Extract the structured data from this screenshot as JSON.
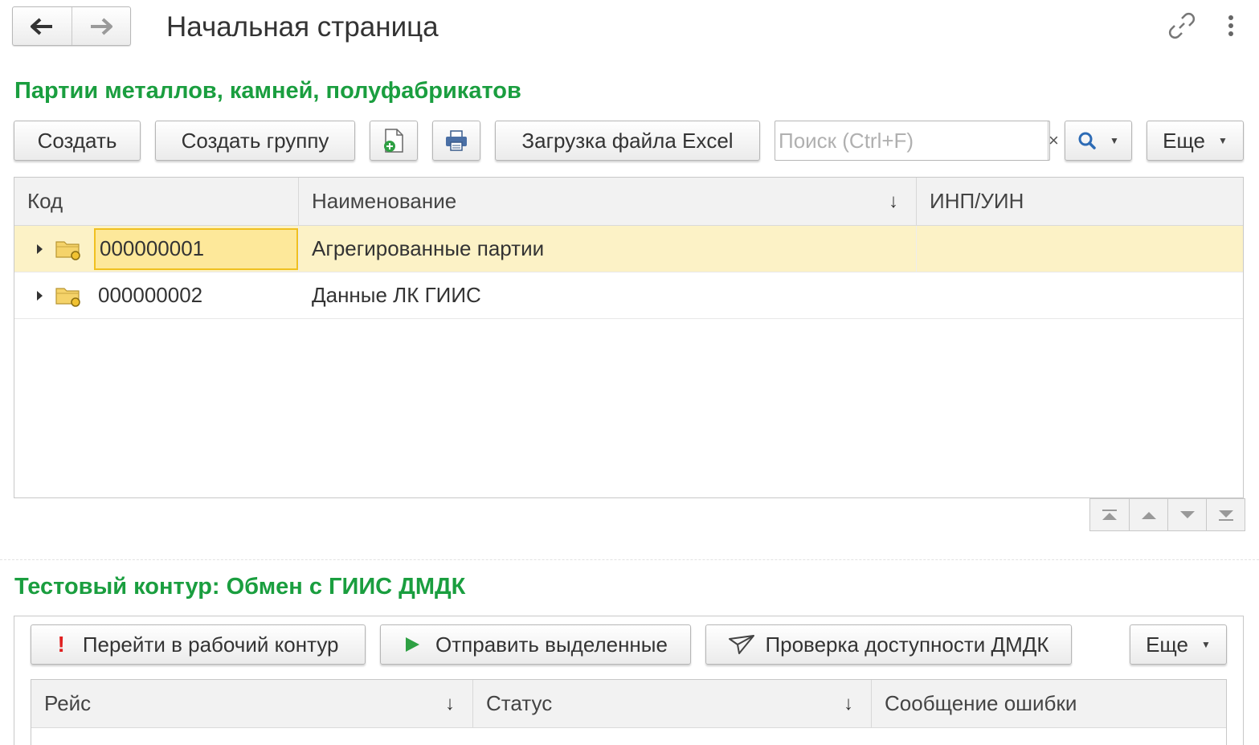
{
  "header": {
    "back_icon": "arrow-left-icon",
    "forward_icon": "arrow-right-icon",
    "title": "Начальная страница",
    "link_icon": "link-icon",
    "more_icon": "vertical-dots-icon"
  },
  "section1": {
    "title": "Партии металлов, камней, полуфабрикатов",
    "toolbar": {
      "create_label": "Создать",
      "create_group_label": "Создать группу",
      "add_icon": "document-add-icon",
      "print_icon": "printer-icon",
      "excel_label": "Загрузка файла Excel",
      "search_placeholder": "Поиск (Ctrl+F)",
      "search_value": "",
      "clear_label": "×",
      "search_icon": "magnifier-icon",
      "more_label": "Еще"
    },
    "table": {
      "columns": [
        "Код",
        "Наименование",
        "ИНП/УИН"
      ],
      "sort_arrow": "↓",
      "rows": [
        {
          "code": "000000001",
          "name": "Агрегированные партии",
          "inp": "",
          "selected": true
        },
        {
          "code": "000000002",
          "name": "Данные ЛК ГИИС",
          "inp": "",
          "selected": false
        }
      ]
    },
    "scroll_icons": [
      "scroll-top-icon",
      "scroll-up-icon",
      "scroll-down-icon",
      "scroll-bottom-icon"
    ]
  },
  "section2": {
    "title": "Тестовый контур: Обмен с ГИИС ДМДК",
    "toolbar": {
      "goto_label": "Перейти в рабочий контур",
      "send_label": "Отправить выделенные",
      "check_label": "Проверка доступности ДМДК",
      "more_label": "Еще"
    },
    "table": {
      "columns": [
        "Рейс",
        "Статус",
        "Сообщение ошибки"
      ],
      "sort_arrow": "↓"
    }
  },
  "colors": {
    "accent_green": "#1a9e3f",
    "selection_row": "#fcf2c6",
    "focused_cell": "#fde89a",
    "focused_border": "#f0c020"
  }
}
